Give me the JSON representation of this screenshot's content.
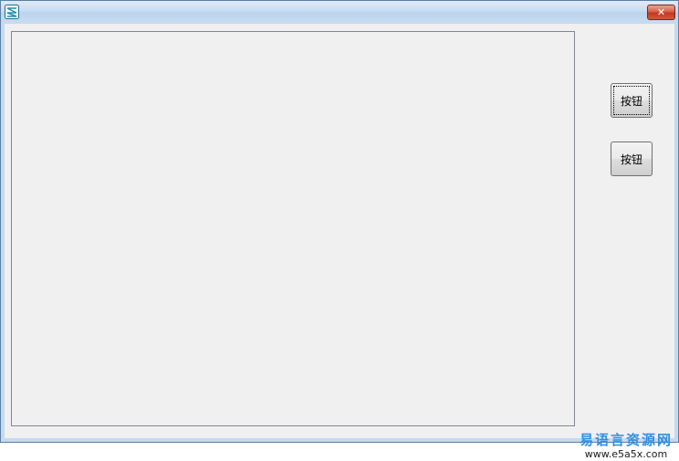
{
  "window": {
    "title": "",
    "close_label": "✕"
  },
  "buttons": [
    {
      "label": "按钮"
    },
    {
      "label": "按钮"
    }
  ],
  "editbox": {
    "value": ""
  },
  "watermark": {
    "text": "易语言资源网",
    "url": "www.e5a5x.com"
  },
  "icons": {
    "app": "app-icon",
    "close": "close-icon"
  },
  "colors": {
    "client_bg": "#f0f0f0",
    "titlebar": "#c9dcf1",
    "close_button": "#c2391e",
    "watermark_text": "#2f8fe0"
  }
}
